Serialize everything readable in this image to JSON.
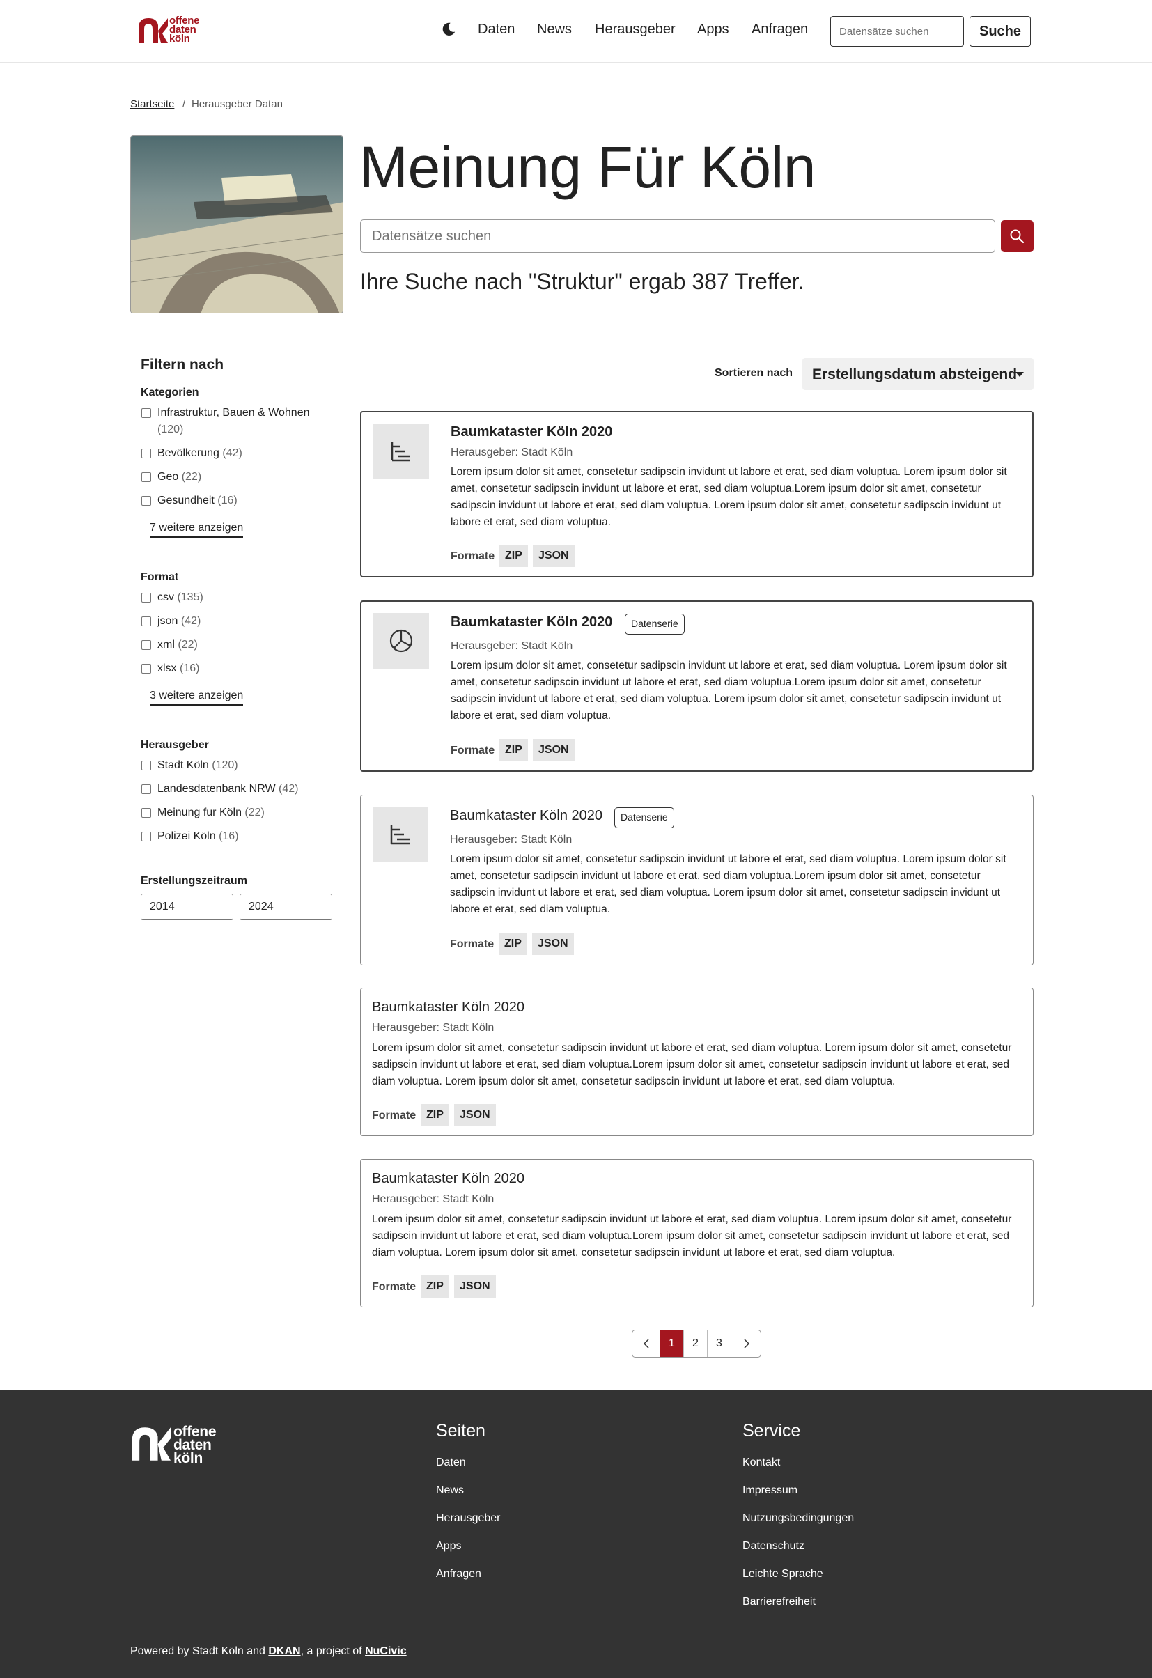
{
  "header": {
    "logo_lines": [
      "offene",
      "daten",
      "köln"
    ],
    "nav": [
      "Daten",
      "News",
      "Herausgeber",
      "Apps",
      "Anfragen"
    ],
    "search_placeholder": "Datensätze suchen",
    "search_button": "Suche",
    "brand_color": "#a4161f"
  },
  "breadcrumb": {
    "home": "Startseite",
    "separator": "/",
    "current": "Herausgeber Datan"
  },
  "hero": {
    "title": "Meinung Für Köln",
    "search_placeholder": "Datensätze suchen",
    "result_text": "Ihre Suche nach \"Struktur\" ergab 387 Treffer."
  },
  "filters": {
    "title": "Filtern nach",
    "categories": {
      "title": "Kategorien",
      "items": [
        {
          "label": "Infrastruktur, Bauen & Wohnen",
          "count": "(120)"
        },
        {
          "label": "Bevölkerung",
          "count": "(42)"
        },
        {
          "label": "Geo",
          "count": "(22)"
        },
        {
          "label": "Gesundheit",
          "count": "(16)"
        }
      ],
      "more": "7 weitere anzeigen"
    },
    "format": {
      "title": "Format",
      "items": [
        {
          "label": "csv",
          "count": "(135)"
        },
        {
          "label": "json",
          "count": "(42)"
        },
        {
          "label": "xml",
          "count": "(22)"
        },
        {
          "label": "xlsx",
          "count": "(16)"
        }
      ],
      "more": "3 weitere anzeigen"
    },
    "publisher": {
      "title": "Herausgeber",
      "items": [
        {
          "label": "Stadt Köln",
          "count": "(120)"
        },
        {
          "label": "Landesdatenbank NRW",
          "count": "(42)"
        },
        {
          "label": "Meinung fur Köln",
          "count": "(22)"
        },
        {
          "label": "Polizei Köln",
          "count": "(16)"
        }
      ]
    },
    "period": {
      "title": "Erstellungszeitraum",
      "from": "2014",
      "to": "2024"
    }
  },
  "sort": {
    "label": "Sortieren nach",
    "value": "Erstellungsdatum absteigend"
  },
  "results": [
    {
      "title": "Baumkataster Köln 2020",
      "tag": "",
      "publisher": "Herausgeber: Stadt Köln",
      "description": "Lorem ipsum dolor sit amet, consetetur sadipscin invidunt ut labore et erat, sed diam voluptua. Lorem ipsum dolor sit amet, consetetur sadipscin invidunt ut labore et erat, sed diam voluptua.Lorem ipsum dolor sit amet, consetetur sadipscin invidunt ut labore et erat, sed diam voluptua. Lorem ipsum dolor sit amet, consetetur sadipscin invidunt ut labore et erat, sed diam voluptua.",
      "formats_label": "Formate",
      "formats": [
        "ZIP",
        "JSON"
      ],
      "icon": "list-icon"
    },
    {
      "title": "Baumkataster Köln 2020",
      "tag": "Datenserie",
      "publisher": "Herausgeber: Stadt Köln",
      "description": "Lorem ipsum dolor sit amet, consetetur sadipscin invidunt ut labore et erat, sed diam voluptua. Lorem ipsum dolor sit amet, consetetur sadipscin invidunt ut labore et erat, sed diam voluptua.Lorem ipsum dolor sit amet, consetetur sadipscin invidunt ut labore et erat, sed diam voluptua. Lorem ipsum dolor sit amet, consetetur sadipscin invidunt ut labore et erat, sed diam voluptua.",
      "formats_label": "Formate",
      "formats": [
        "ZIP",
        "JSON"
      ],
      "icon": "pie-chart-icon"
    },
    {
      "title": "Baumkataster Köln 2020",
      "tag": "Datenserie",
      "publisher": "Herausgeber: Stadt Köln",
      "description": "Lorem ipsum dolor sit amet, consetetur sadipscin invidunt ut labore et erat, sed diam voluptua. Lorem ipsum dolor sit amet, consetetur sadipscin invidunt ut labore et erat, sed diam voluptua.Lorem ipsum dolor sit amet, consetetur sadipscin invidunt ut labore et erat, sed diam voluptua. Lorem ipsum dolor sit amet, consetetur sadipscin invidunt ut labore et erat, sed diam voluptua.",
      "formats_label": "Formate",
      "formats": [
        "ZIP",
        "JSON"
      ],
      "icon": "list-icon"
    },
    {
      "title": "Baumkataster Köln 2020",
      "publisher": "Herausgeber: Stadt Köln",
      "description": "Lorem ipsum dolor sit amet, consetetur sadipscin invidunt ut labore et erat, sed diam voluptua. Lorem ipsum dolor sit amet, consetetur sadipscin invidunt ut labore et erat, sed diam voluptua.Lorem ipsum dolor sit amet, consetetur sadipscin invidunt ut labore et erat, sed diam voluptua. Lorem ipsum dolor sit amet, consetetur sadipscin invidunt ut labore et erat, sed diam voluptua.",
      "formats_label": "Formate",
      "formats": [
        "ZIP",
        "JSON"
      ]
    },
    {
      "title": "Baumkataster Köln 2020",
      "publisher": "Herausgeber: Stadt Köln",
      "description": "Lorem ipsum dolor sit amet, consetetur sadipscin invidunt ut labore et erat, sed diam voluptua. Lorem ipsum dolor sit amet, consetetur sadipscin invidunt ut labore et erat, sed diam voluptua.Lorem ipsum dolor sit amet, consetetur sadipscin invidunt ut labore et erat, sed diam voluptua. Lorem ipsum dolor sit amet, consetetur sadipscin invidunt ut labore et erat, sed diam voluptua.",
      "formats_label": "Formate",
      "formats": [
        "ZIP",
        "JSON"
      ]
    }
  ],
  "pagination": {
    "pages": [
      "1",
      "2",
      "3"
    ],
    "current": "1"
  },
  "footer": {
    "logo_lines": [
      "offene",
      "daten",
      "köln"
    ],
    "seiten": {
      "title": "Seiten",
      "links": [
        "Daten",
        "News",
        "Herausgeber",
        "Apps",
        "Anfragen"
      ]
    },
    "service": {
      "title": "Service",
      "links": [
        "Kontakt",
        "Impressum",
        "Nutzungsbedingungen",
        "Datenschutz",
        "Leichte Sprache",
        "Barrierefreiheit"
      ]
    },
    "powered": {
      "prefix": "Powered by Stadt Köln and ",
      "dkan": "DKAN",
      "middle": ", a project of ",
      "nucivic": "NuCivic"
    },
    "background": "#333333"
  }
}
